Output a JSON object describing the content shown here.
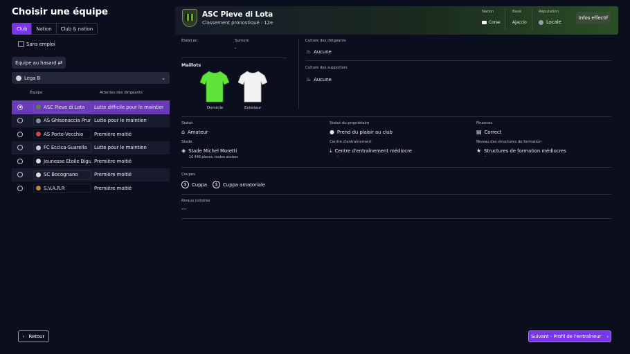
{
  "page": {
    "title": "Choisir une équipe"
  },
  "filter_tabs": [
    "Club",
    "Nation",
    "Club & nation"
  ],
  "unemployed_label": "Sans emploi",
  "random_team_label": "Équipe au hasard",
  "league": "Lega B",
  "table": {
    "headers": [
      "Équipe",
      "Attentes des dirigeants"
    ],
    "rows": [
      {
        "team": "ASC Pieve di Lota",
        "expectation": "Lutte difficile pour le maintien",
        "selected": true
      },
      {
        "team": "AS Ghisonaccia Prunelli",
        "expectation": "Lutte pour le maintien",
        "selected": false
      },
      {
        "team": "AS Porto-Vecchio",
        "expectation": "Première moitié",
        "selected": false
      },
      {
        "team": "FC Eccica-Suarella",
        "expectation": "Lutte pour le maintien",
        "selected": false
      },
      {
        "team": "Jeunesse Etoile Bigugliaise",
        "expectation": "Première moitié",
        "selected": false
      },
      {
        "team": "SC Bocognano",
        "expectation": "Première moitié",
        "selected": false
      },
      {
        "team": "S.V.A.R.R",
        "expectation": "Première moitié",
        "selected": false
      }
    ]
  },
  "club": {
    "name": "ASC Pieve di Lota",
    "prediction": "Classement pronostiqué : 12e",
    "nation_label": "Nation",
    "nation_value": "Corse",
    "based_label": "Basé",
    "based_value": "Ajaccio",
    "reputation_label": "Réputation",
    "reputation_value": "Locale",
    "info_button": "Infos effectif"
  },
  "details": {
    "founded_label": "Établi en",
    "founded_value": "",
    "nickname_label": "Surnom",
    "nickname_value": "-",
    "kits_label": "Maillots",
    "home_label": "Domicile",
    "away_label": "Extérieur",
    "home_color": "#5fe43a",
    "away_color": "#f2f2f2",
    "board_culture_label": "Culture des dirigeants",
    "board_culture_value": "Aucune",
    "supporter_culture_label": "Culture des supporters",
    "supporter_culture_value": "Aucune",
    "status_label": "Statut",
    "status_value": "Amateur",
    "owner_label": "Statut du propriétaire",
    "owner_value": "Prend du plaisir au club",
    "finances_label": "Finances",
    "finances_value": "Correct",
    "stadium_label": "Stade",
    "stadium_value": "Stade Michel Moretti",
    "stadium_capacity": "10 446 places, toutes assises",
    "training_label": "Centre d'entraînement",
    "training_value": "Centre d'entraînement médiocre",
    "training_sub": "-",
    "youth_label": "Niveau des structures de formation",
    "youth_value": "Structures de formation médiocres",
    "youth_sub": "-",
    "cups_label": "Coupes",
    "cups": [
      "Cuppa",
      "Cuppa amatoriale"
    ],
    "rivals_label": "Rivaux notoires",
    "rivals_value": "---"
  },
  "footer": {
    "back_label": "Retour",
    "next_label": "Suivant - Profil de l'entraîneur"
  }
}
